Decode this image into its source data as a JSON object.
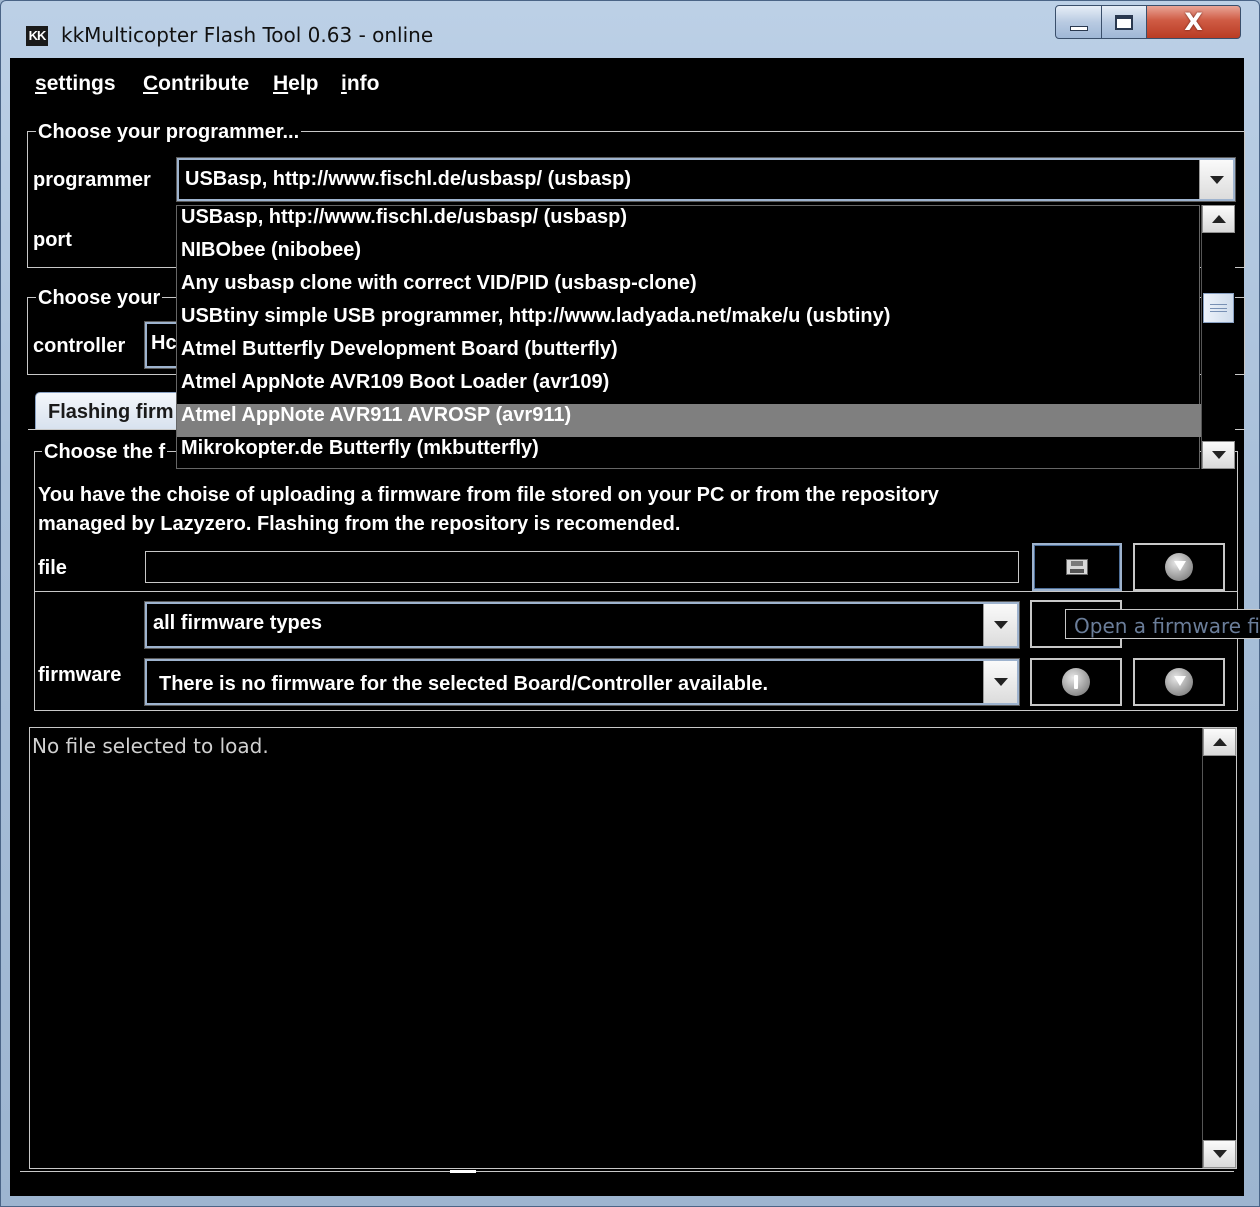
{
  "window": {
    "title": "kkMulticopter Flash Tool 0.63 - online",
    "icon": "kk-app-icon",
    "controls": {
      "minimize": "minimize-icon",
      "maximize": "maximize-icon",
      "close_glyph": "X"
    }
  },
  "menu": [
    {
      "first": "s",
      "rest": "ettings"
    },
    {
      "first": "C",
      "rest": "ontribute"
    },
    {
      "first": "H",
      "rest": "elp"
    },
    {
      "first": "i",
      "rest": "nfo"
    }
  ],
  "programmer_group": {
    "title": "Choose your programmer...",
    "programmer_label": "programmer",
    "programmer_value": "USBasp, http://www.fischl.de/usbasp/ (usbasp)",
    "port_label": "port"
  },
  "controller_group": {
    "title_partial": "Choose your",
    "controller_label": "controller",
    "controller_value_partial": "Hc"
  },
  "dropdown": {
    "items": [
      "USBasp, http://www.fischl.de/usbasp/ (usbasp)",
      "NIBObee (nibobee)",
      "Any usbasp clone with correct VID/PID (usbasp-clone)",
      "USBtiny simple USB programmer, http://www.ladyada.net/make/u (usbtiny)",
      "Atmel Butterfly Development Board (butterfly)",
      "Atmel AppNote AVR109 Boot Loader (avr109)",
      "Atmel AppNote AVR911 AVROSP (avr911)",
      "Mikrokopter.de Butterfly (mkbutterfly)"
    ],
    "selected_index": 6
  },
  "tab": {
    "label": "Flashing firm"
  },
  "firmware_group": {
    "title_partial": "Choose the f",
    "description_line1": "You have the choise of uploading a firmware from file stored on your PC or from the repository",
    "description_line2": "managed by Lazyzero. Flashing from the repository is recomended.",
    "file_label": "file",
    "file_value": "",
    "type_value": "all firmware types",
    "firmware_label": "firmware",
    "firmware_value": "There is no firmware for the selected Board/Controller available."
  },
  "tooltip": "Open a firmware fi",
  "log": {
    "text": "No file selected to load."
  },
  "colors": {
    "background": "#000000",
    "text": "#ffffff",
    "selection": "#7f7f7f",
    "focus_border": "#9eb3ce"
  }
}
